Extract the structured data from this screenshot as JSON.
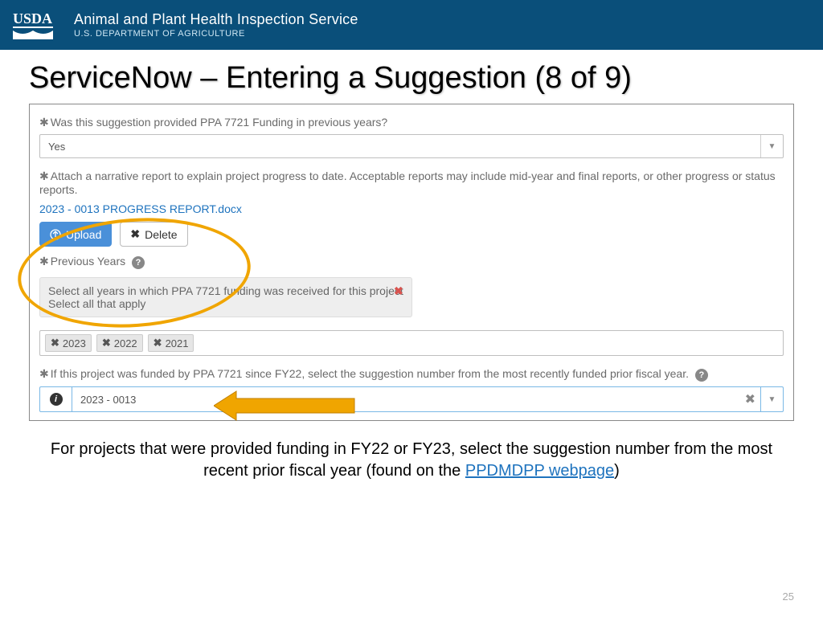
{
  "header": {
    "agency": "Animal and Plant Health Inspection Service",
    "dept": "U.S. DEPARTMENT OF AGRICULTURE",
    "logo_text": "USDA"
  },
  "title": "ServiceNow – Entering a Suggestion (8 of 9)",
  "form": {
    "q_funding": {
      "label": "Was this suggestion provided PPA 7721 Funding in previous years?",
      "value": "Yes"
    },
    "q_attach": {
      "label": "Attach a narrative report to explain project progress to date. Acceptable reports may include mid-year and final reports, or other progress or status reports.",
      "file": "2023 - 0013 PROGRESS REPORT.docx"
    },
    "upload_label": "Upload",
    "delete_label": "Delete",
    "prev_years": {
      "label": "Previous Years",
      "box_line1": "Select all years in which PPA 7721 funding was received for this project",
      "box_line2": "Select all that apply",
      "chips": [
        "2023",
        "2022",
        "2021"
      ]
    },
    "q_suggestion": {
      "label": "If this project was funded by PPA 7721 since FY22, select the suggestion number from the most recently funded prior fiscal year.",
      "value": "2023 - 0013"
    }
  },
  "caption": {
    "text1": "For projects that were provided funding in FY22 or FY23, select the suggestion number from the most recent prior fiscal year (found on the ",
    "link": "PPDMDPP webpage",
    "text2": ")"
  },
  "page_number": "25",
  "colors": {
    "brand": "#0a4f7a",
    "accent": "#f0a500",
    "primary_btn": "#4a90d9",
    "link": "#1e73be"
  }
}
